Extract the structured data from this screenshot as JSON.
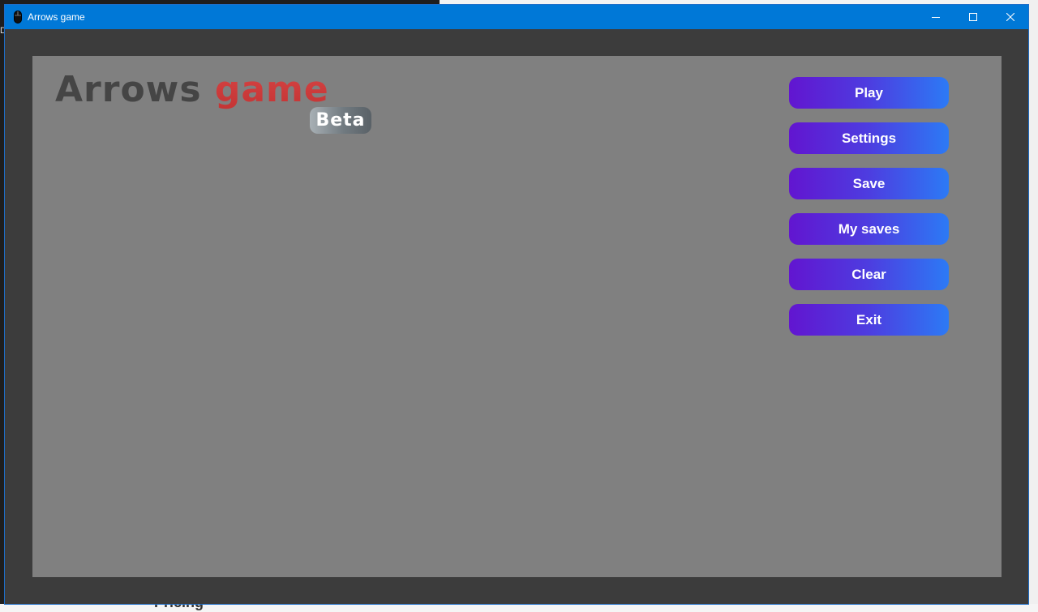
{
  "window": {
    "title": "Arrows game",
    "controls": {
      "minimize_icon": "minimize-icon",
      "maximize_icon": "maximize-icon",
      "close_icon": "close-icon"
    },
    "accent_color": "#0078d7"
  },
  "game": {
    "logo": {
      "word1": "Arrows",
      "word2": "game",
      "word1_color": "#454545",
      "word2_color": "#d03a3a"
    },
    "badge": "Beta",
    "canvas_color": "#808080",
    "menu": [
      {
        "label": "Play"
      },
      {
        "label": "Settings"
      },
      {
        "label": "Save"
      },
      {
        "label": "My saves"
      },
      {
        "label": "Clear"
      },
      {
        "label": "Exit"
      }
    ],
    "button_gradient": [
      "#6215d0",
      "#2c7af5"
    ]
  },
  "background": {
    "left_char": "D",
    "bottom_text": "Pricing"
  }
}
